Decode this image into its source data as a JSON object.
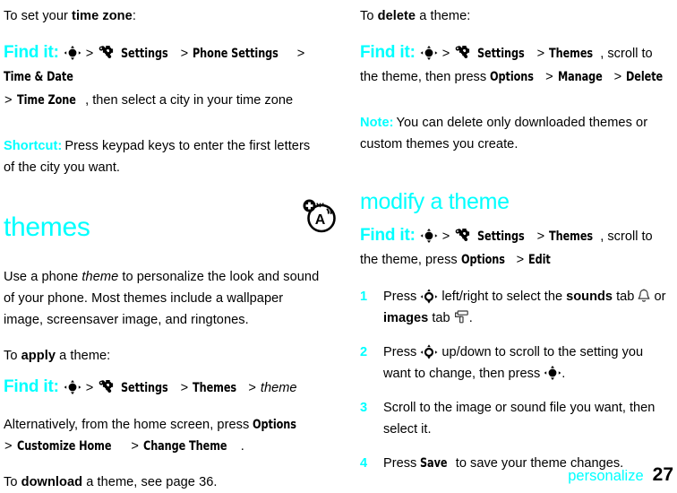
{
  "page": {
    "chapter": "personalize",
    "number": "27"
  },
  "left_column": {
    "intro": {
      "before": "To set your ",
      "bold": "time zone",
      "after": ":"
    },
    "findit_timezone": {
      "label": "Find it:",
      "nav_icon": "navigation-key-icon",
      "settings_icon": "settings-gear-wrench-icon",
      "path": [
        "Settings",
        "Phone Settings",
        "Time & Date",
        "Time Zone"
      ],
      "tail": ", then select a city in your time zone"
    },
    "shortcut": {
      "label": "Shortcut:",
      "text": "Press keypad keys to enter the first letters of the city you want."
    },
    "heading_themes": "themes",
    "themes_intro": {
      "part1": "Use a phone ",
      "italic": "theme",
      "part2": " to personalize the look and sound of your phone. Most themes include a wallpaper image, screensaver image, and ringtones."
    },
    "margin_icon": "theme-sound-icon",
    "apply_intro": {
      "before": "To ",
      "bold": "apply",
      "after": " a theme:"
    },
    "findit_apply": {
      "label": "Find it:",
      "nav_icon": "navigation-key-icon",
      "settings_icon": "settings-gear-wrench-icon",
      "path": [
        "Settings",
        "Themes"
      ],
      "italic_tail": "theme"
    },
    "alternative": {
      "before": "Alternatively, from the home screen, press ",
      "menu1": "Options",
      "menu2": "Customize Home",
      "menu3": "Change Theme",
      "after": "."
    },
    "download_note": {
      "before": "To ",
      "bold": "download",
      "after": " a theme, see page 36."
    }
  },
  "right_column": {
    "delete_intro": {
      "before": "To ",
      "bold": "delete",
      "after": " a theme:"
    },
    "findit_delete": {
      "label": "Find it:",
      "nav_icon": "navigation-key-icon",
      "settings_icon": "settings-gear-wrench-icon",
      "path": [
        "Settings",
        "Themes"
      ],
      "tail": ", scroll to the theme, then press ",
      "menu_options": "Options",
      "menu_manage": "Manage",
      "menu_delete": "Delete"
    },
    "note": {
      "label": "Note:",
      "text": "You can delete only downloaded themes or custom themes you create."
    },
    "heading_modify": "modify a theme",
    "findit_modify": {
      "label": "Find it:",
      "nav_icon": "navigation-key-icon",
      "settings_icon": "settings-gear-wrench-icon",
      "path": [
        "Settings",
        "Themes"
      ],
      "tail": ", scroll to the theme, press ",
      "menu_options": "Options",
      "menu_edit": "Edit"
    },
    "steps": [
      {
        "number": "1",
        "part1": "Press ",
        "nav_icon": "navigation-key-hollow-icon",
        "part2": " left/right to select the ",
        "bold1": "sounds",
        "part3": " tab ",
        "icon1": "bell-icon",
        "part4": " or ",
        "bold2": "images",
        "part5": " tab ",
        "icon2": "paint-roller-icon",
        "part6": "."
      },
      {
        "number": "2",
        "part1": "Press ",
        "nav_icon": "navigation-key-hollow-icon",
        "part2": " up/down to scroll to the setting you want to change, then press ",
        "nav_icon2": "navigation-key-icon",
        "part3": "."
      },
      {
        "number": "3",
        "part1": "Scroll to the image or sound file you want, then select it."
      },
      {
        "number": "4",
        "part1": "Press ",
        "bold1": "Save",
        "part2": " to save your theme changes."
      }
    ]
  }
}
